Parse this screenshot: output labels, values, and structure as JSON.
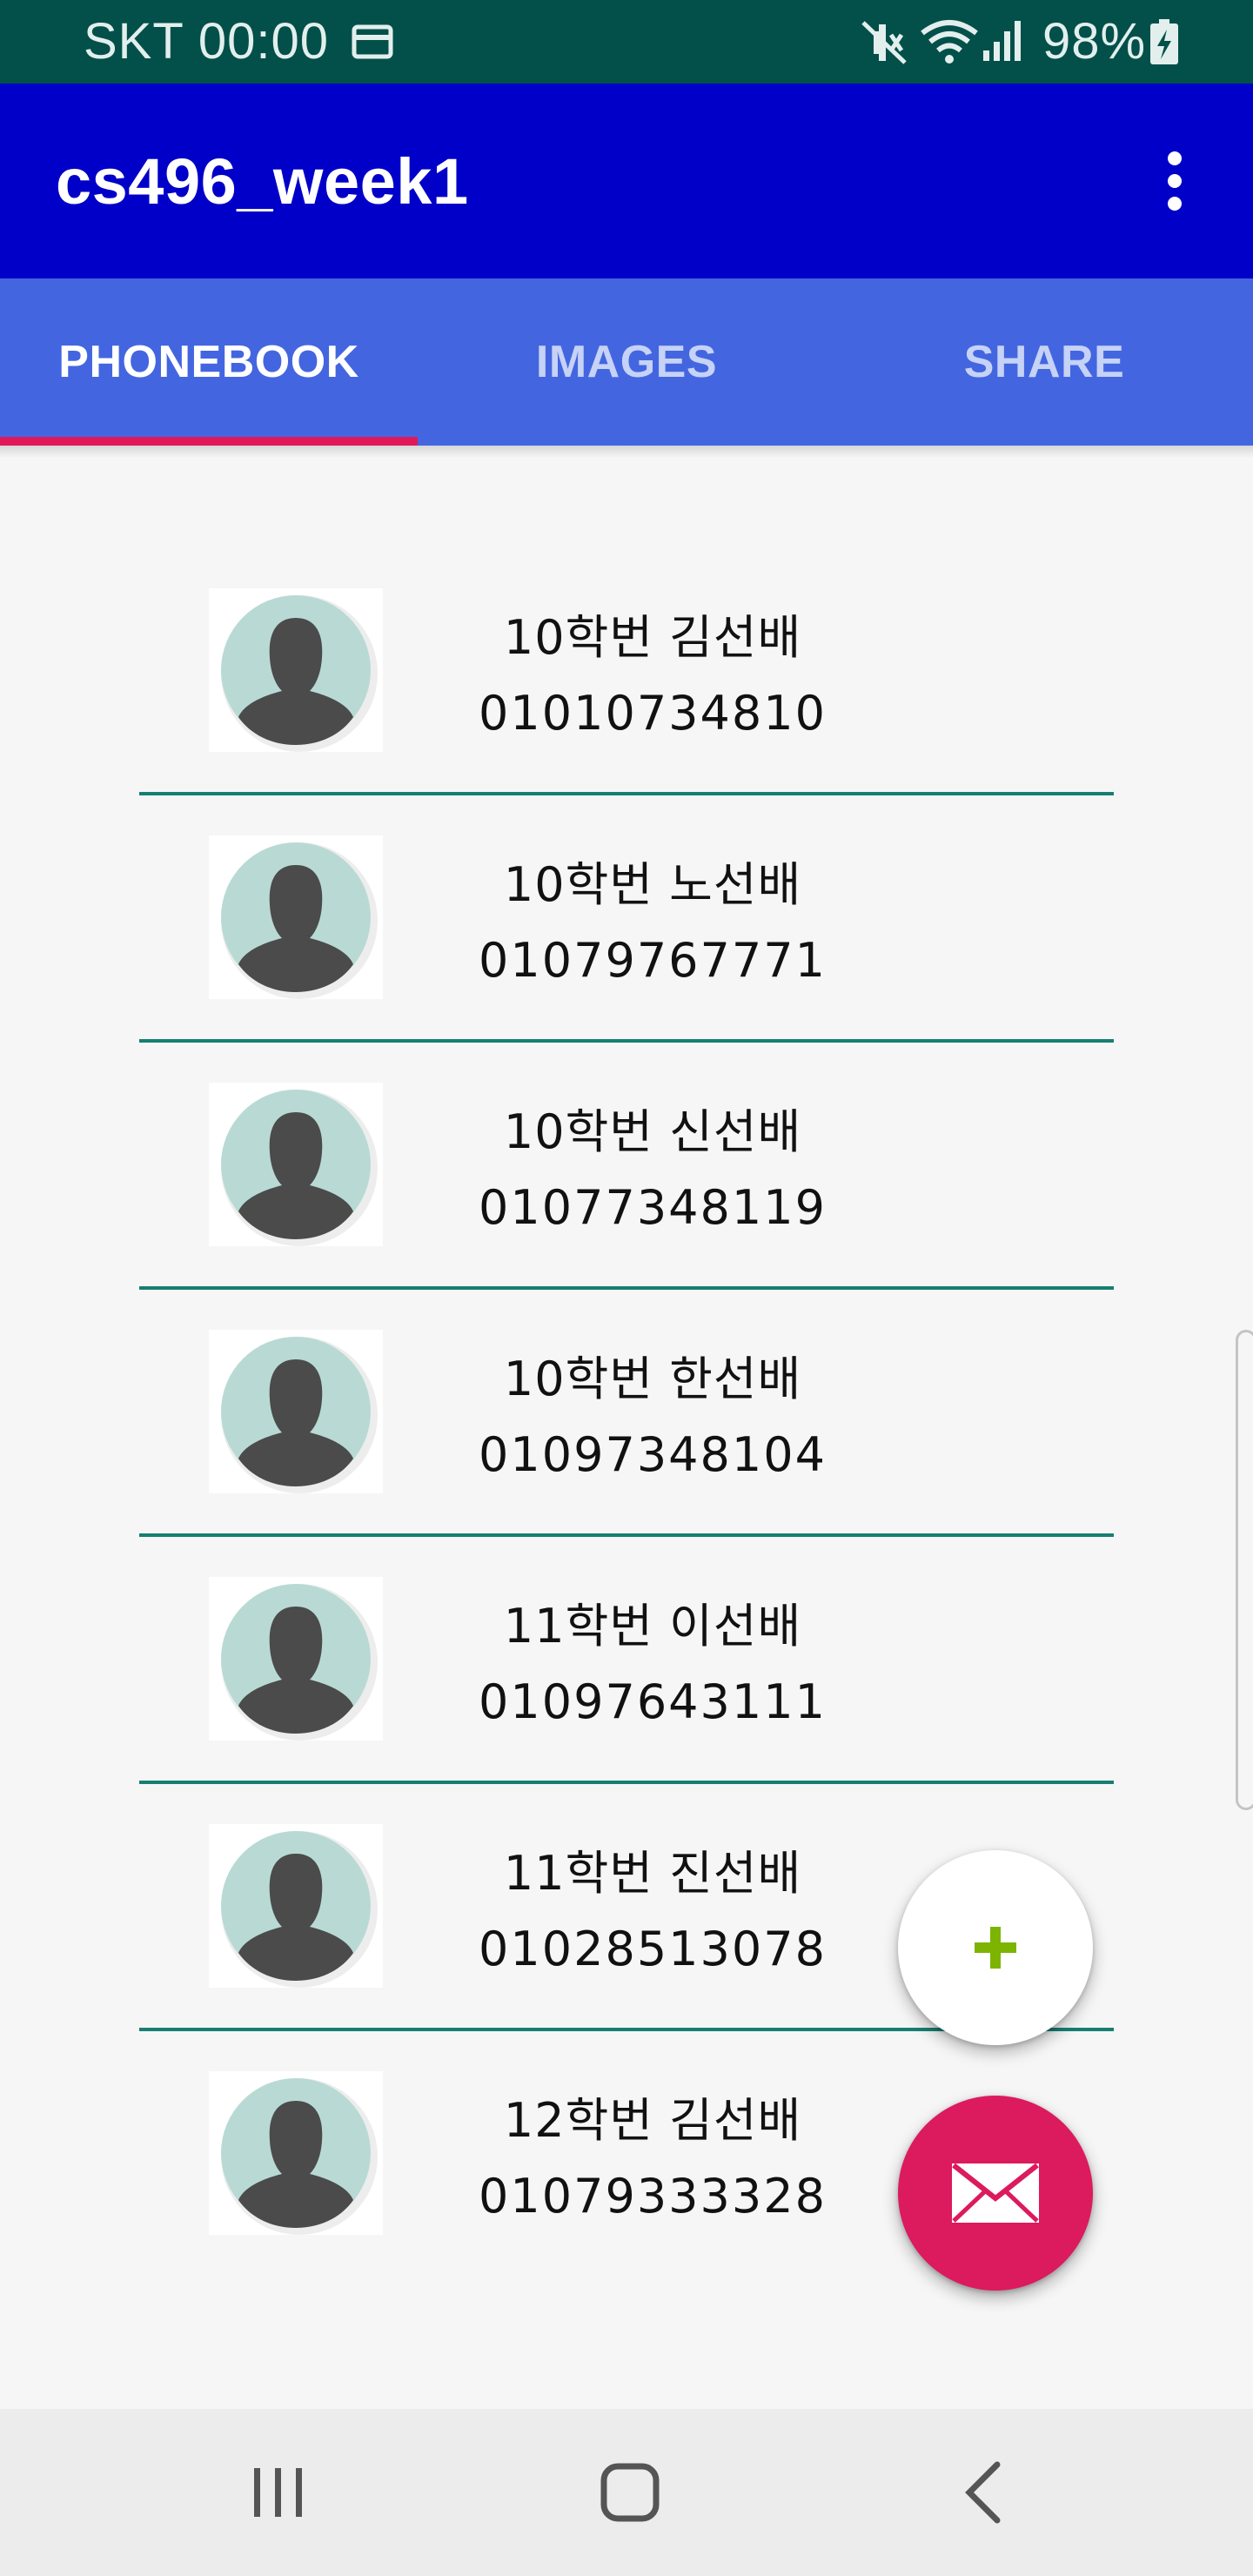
{
  "status_bar": {
    "carrier_time": "SKT 00:00",
    "battery": "98%",
    "icons": [
      "sim-card-icon",
      "mute-icon",
      "wifi-icon",
      "signal-icon",
      "battery-charging-icon"
    ]
  },
  "app_bar": {
    "title": "cs496_week1",
    "menu_icon": "more-vert-icon"
  },
  "tabs": [
    {
      "label": "PHONEBOOK",
      "active": true
    },
    {
      "label": "IMAGES",
      "active": false
    },
    {
      "label": "SHARE",
      "active": false
    }
  ],
  "contacts": [
    {
      "name": "10학번 김선배",
      "phone": "01010734810"
    },
    {
      "name": "10학번 노선배",
      "phone": "01079767771"
    },
    {
      "name": "10학번 신선배",
      "phone": "01077348119"
    },
    {
      "name": "10학번 한선배",
      "phone": "01097348104"
    },
    {
      "name": "11학번 이선배",
      "phone": "01097643111"
    },
    {
      "name": "11학번 진선배",
      "phone": "01028513078"
    },
    {
      "name": "12학번 김선배",
      "phone": "01079333328"
    }
  ],
  "fabs": {
    "add_icon": "plus-icon",
    "mail_icon": "mail-icon"
  },
  "nav_bar": {
    "icons": [
      "recent-apps-icon",
      "home-icon",
      "back-icon"
    ]
  },
  "colors": {
    "status_bar": "#03504a",
    "app_bar": "#0000c8",
    "tab_bar": "#4366e0",
    "tab_indicator": "#e0185a",
    "divider": "#177e72",
    "fab_mail": "#dc1a5e",
    "fab_add_icon": "#7cb400"
  }
}
